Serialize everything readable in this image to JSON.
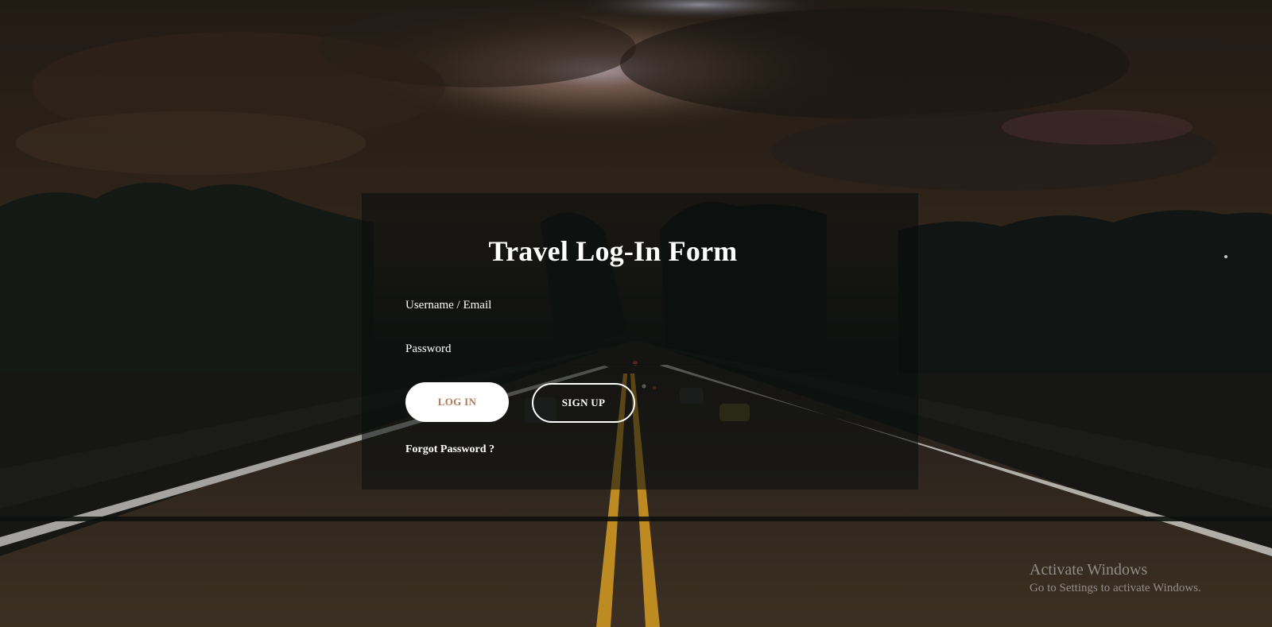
{
  "form": {
    "title": "Travel Log-In Form",
    "username_placeholder": "Username / Email",
    "password_placeholder": "Password",
    "login_label": "LOG IN",
    "signup_label": "SIGN UP",
    "forgot_label": "Forgot Password ?"
  },
  "watermark": {
    "title": "Activate Windows",
    "subtitle": "Go to Settings to activate Windows."
  },
  "colors": {
    "panel_overlay": "rgba(8,12,12,0.55)",
    "login_text": "#b07a56",
    "road_line": "#e8a92a"
  }
}
